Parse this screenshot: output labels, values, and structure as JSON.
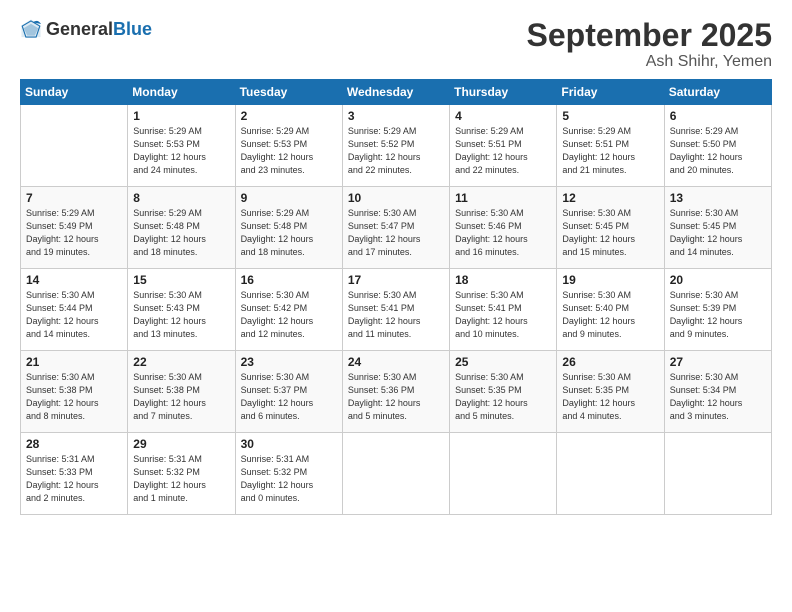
{
  "logo": {
    "general": "General",
    "blue": "Blue"
  },
  "title": "September 2025",
  "location": "Ash Shihr, Yemen",
  "headers": [
    "Sunday",
    "Monday",
    "Tuesday",
    "Wednesday",
    "Thursday",
    "Friday",
    "Saturday"
  ],
  "weeks": [
    [
      {
        "day": "",
        "info": ""
      },
      {
        "day": "1",
        "info": "Sunrise: 5:29 AM\nSunset: 5:53 PM\nDaylight: 12 hours\nand 24 minutes."
      },
      {
        "day": "2",
        "info": "Sunrise: 5:29 AM\nSunset: 5:53 PM\nDaylight: 12 hours\nand 23 minutes."
      },
      {
        "day": "3",
        "info": "Sunrise: 5:29 AM\nSunset: 5:52 PM\nDaylight: 12 hours\nand 22 minutes."
      },
      {
        "day": "4",
        "info": "Sunrise: 5:29 AM\nSunset: 5:51 PM\nDaylight: 12 hours\nand 22 minutes."
      },
      {
        "day": "5",
        "info": "Sunrise: 5:29 AM\nSunset: 5:51 PM\nDaylight: 12 hours\nand 21 minutes."
      },
      {
        "day": "6",
        "info": "Sunrise: 5:29 AM\nSunset: 5:50 PM\nDaylight: 12 hours\nand 20 minutes."
      }
    ],
    [
      {
        "day": "7",
        "info": "Sunrise: 5:29 AM\nSunset: 5:49 PM\nDaylight: 12 hours\nand 19 minutes."
      },
      {
        "day": "8",
        "info": "Sunrise: 5:29 AM\nSunset: 5:48 PM\nDaylight: 12 hours\nand 18 minutes."
      },
      {
        "day": "9",
        "info": "Sunrise: 5:29 AM\nSunset: 5:48 PM\nDaylight: 12 hours\nand 18 minutes."
      },
      {
        "day": "10",
        "info": "Sunrise: 5:30 AM\nSunset: 5:47 PM\nDaylight: 12 hours\nand 17 minutes."
      },
      {
        "day": "11",
        "info": "Sunrise: 5:30 AM\nSunset: 5:46 PM\nDaylight: 12 hours\nand 16 minutes."
      },
      {
        "day": "12",
        "info": "Sunrise: 5:30 AM\nSunset: 5:45 PM\nDaylight: 12 hours\nand 15 minutes."
      },
      {
        "day": "13",
        "info": "Sunrise: 5:30 AM\nSunset: 5:45 PM\nDaylight: 12 hours\nand 14 minutes."
      }
    ],
    [
      {
        "day": "14",
        "info": "Sunrise: 5:30 AM\nSunset: 5:44 PM\nDaylight: 12 hours\nand 14 minutes."
      },
      {
        "day": "15",
        "info": "Sunrise: 5:30 AM\nSunset: 5:43 PM\nDaylight: 12 hours\nand 13 minutes."
      },
      {
        "day": "16",
        "info": "Sunrise: 5:30 AM\nSunset: 5:42 PM\nDaylight: 12 hours\nand 12 minutes."
      },
      {
        "day": "17",
        "info": "Sunrise: 5:30 AM\nSunset: 5:41 PM\nDaylight: 12 hours\nand 11 minutes."
      },
      {
        "day": "18",
        "info": "Sunrise: 5:30 AM\nSunset: 5:41 PM\nDaylight: 12 hours\nand 10 minutes."
      },
      {
        "day": "19",
        "info": "Sunrise: 5:30 AM\nSunset: 5:40 PM\nDaylight: 12 hours\nand 9 minutes."
      },
      {
        "day": "20",
        "info": "Sunrise: 5:30 AM\nSunset: 5:39 PM\nDaylight: 12 hours\nand 9 minutes."
      }
    ],
    [
      {
        "day": "21",
        "info": "Sunrise: 5:30 AM\nSunset: 5:38 PM\nDaylight: 12 hours\nand 8 minutes."
      },
      {
        "day": "22",
        "info": "Sunrise: 5:30 AM\nSunset: 5:38 PM\nDaylight: 12 hours\nand 7 minutes."
      },
      {
        "day": "23",
        "info": "Sunrise: 5:30 AM\nSunset: 5:37 PM\nDaylight: 12 hours\nand 6 minutes."
      },
      {
        "day": "24",
        "info": "Sunrise: 5:30 AM\nSunset: 5:36 PM\nDaylight: 12 hours\nand 5 minutes."
      },
      {
        "day": "25",
        "info": "Sunrise: 5:30 AM\nSunset: 5:35 PM\nDaylight: 12 hours\nand 5 minutes."
      },
      {
        "day": "26",
        "info": "Sunrise: 5:30 AM\nSunset: 5:35 PM\nDaylight: 12 hours\nand 4 minutes."
      },
      {
        "day": "27",
        "info": "Sunrise: 5:30 AM\nSunset: 5:34 PM\nDaylight: 12 hours\nand 3 minutes."
      }
    ],
    [
      {
        "day": "28",
        "info": "Sunrise: 5:31 AM\nSunset: 5:33 PM\nDaylight: 12 hours\nand 2 minutes."
      },
      {
        "day": "29",
        "info": "Sunrise: 5:31 AM\nSunset: 5:32 PM\nDaylight: 12 hours\nand 1 minute."
      },
      {
        "day": "30",
        "info": "Sunrise: 5:31 AM\nSunset: 5:32 PM\nDaylight: 12 hours\nand 0 minutes."
      },
      {
        "day": "",
        "info": ""
      },
      {
        "day": "",
        "info": ""
      },
      {
        "day": "",
        "info": ""
      },
      {
        "day": "",
        "info": ""
      }
    ]
  ]
}
